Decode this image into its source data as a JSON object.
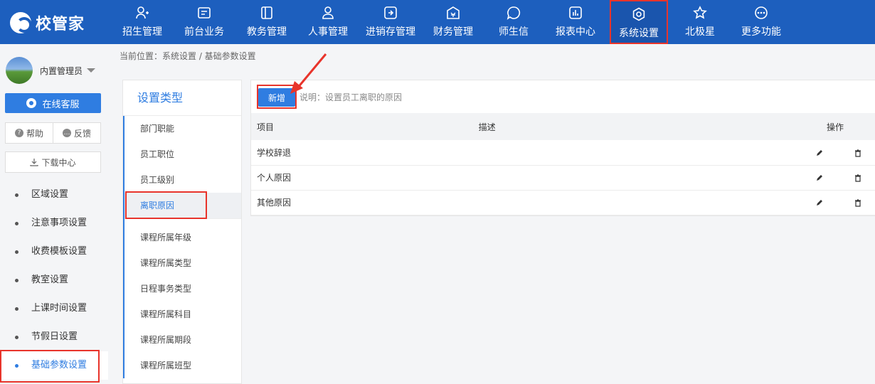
{
  "app": {
    "logo_text": "校管家"
  },
  "nav": [
    {
      "label": "招生管理",
      "icon": "person-add-icon"
    },
    {
      "label": "前台业务",
      "icon": "front-desk-icon"
    },
    {
      "label": "教务管理",
      "icon": "book-icon"
    },
    {
      "label": "人事管理",
      "icon": "person-icon"
    },
    {
      "label": "进销存管理",
      "icon": "inventory-icon"
    },
    {
      "label": "财务管理",
      "icon": "finance-icon"
    },
    {
      "label": "师生信",
      "icon": "message-icon"
    },
    {
      "label": "报表中心",
      "icon": "chart-icon"
    },
    {
      "label": "系统设置",
      "icon": "settings-icon",
      "active": true
    },
    {
      "label": "北极星",
      "icon": "star-icon"
    },
    {
      "label": "更多功能",
      "icon": "more-icon"
    }
  ],
  "user": {
    "name": "内置管理员"
  },
  "sidebar": {
    "service_label": "在线客服",
    "help_label": "帮助",
    "feedback_label": "反馈",
    "download_label": "下载中心",
    "items": [
      {
        "label": "区域设置"
      },
      {
        "label": "注意事项设置"
      },
      {
        "label": "收费模板设置"
      },
      {
        "label": "教室设置"
      },
      {
        "label": "上课时间设置"
      },
      {
        "label": "节假日设置"
      },
      {
        "label": "基础参数设置",
        "active": true
      }
    ]
  },
  "breadcrumb": "当前位置：系统设置 / 基础参数设置",
  "types": {
    "title": "设置类型",
    "group1": [
      {
        "label": "部门职能"
      },
      {
        "label": "员工职位"
      },
      {
        "label": "员工级别"
      },
      {
        "label": "离职原因",
        "active": true
      }
    ],
    "group2": [
      {
        "label": "课程所属年级"
      },
      {
        "label": "课程所属类型"
      },
      {
        "label": "日程事务类型"
      },
      {
        "label": "课程所属科目"
      },
      {
        "label": "课程所属期段"
      },
      {
        "label": "课程所属班型"
      }
    ]
  },
  "main": {
    "new_button": "新增",
    "hint": "说明：设置员工离职的原因",
    "columns": {
      "item": "项目",
      "desc": "描述",
      "ops": "操作"
    },
    "rows": [
      {
        "item": "学校辞退",
        "desc": ""
      },
      {
        "item": "个人原因",
        "desc": ""
      },
      {
        "item": "其他原因",
        "desc": ""
      }
    ]
  },
  "colors": {
    "primary": "#1d5fbe",
    "accent": "#2f7de1",
    "highlight": "#e8342b"
  }
}
